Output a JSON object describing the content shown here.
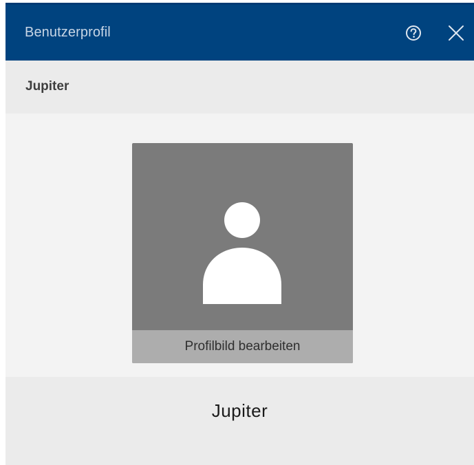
{
  "window": {
    "title": "Benutzerprofil",
    "help_icon": "help-circle-icon",
    "close_icon": "close-icon"
  },
  "profile": {
    "header_name": "Jupiter",
    "display_name": "Jupiter",
    "avatar_icon": "user-placeholder-icon",
    "edit_picture_label": "Profilbild bearbeiten"
  },
  "colors": {
    "titlebar": "#00437f",
    "avatar_background": "#7b7b7b",
    "edit_bar": "#adadad"
  }
}
